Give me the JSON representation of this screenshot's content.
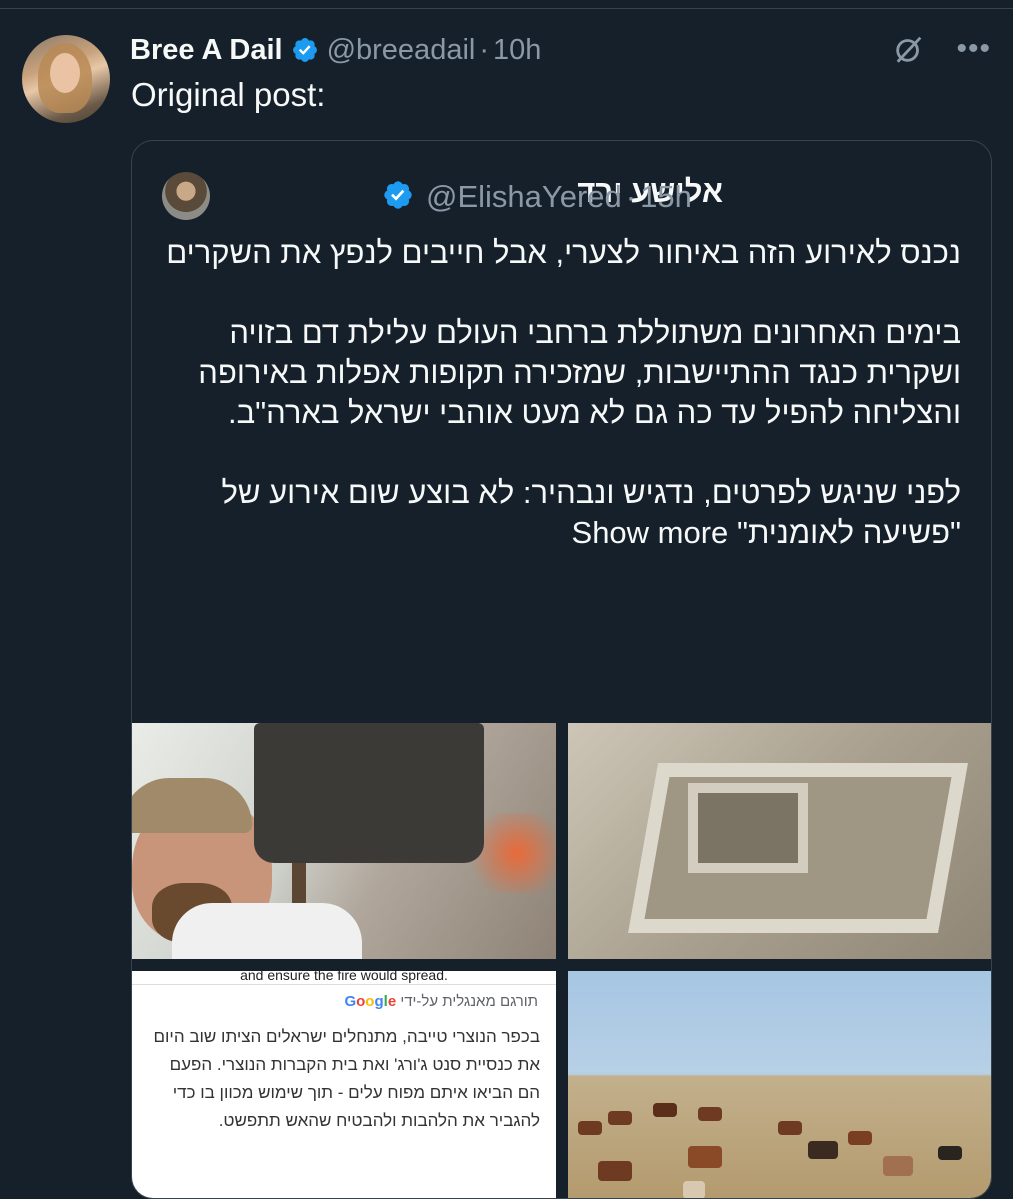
{
  "post": {
    "author_name": "Bree A Dail",
    "handle": "@breeadail",
    "time": "10h",
    "text": "Original post:"
  },
  "quoted": {
    "author_name": "אלישע ירד",
    "handle": "@ElishaYered",
    "time": "15h",
    "paragraphs": [
      "נכנס לאירוע הזה באיחור לצערי, אבל חייבים לנפץ את השקרים",
      "בימים האחרונים משתוללת ברחבי העולם עלילת דם בזויה ושקרית כנגד ההתיישבות, שמזכירה תקופות אפלות באירופה והצליחה להפיל עד כה גם לא מעט אוהבי ישראל בארה\"ב.",
      "לפני שניגש לפרטים, נדגיש ונבהיר: לא בוצע שום אירוע של \"פשיעה לאומנית\""
    ],
    "show_more": "Show more"
  },
  "translation_card": {
    "top_cut_text": "and ensure the fire would spread.",
    "translated_by": "תורגם מאנגלית על-ידי",
    "google": "Google",
    "body": "בכפר הנוצרי טייבה, מתנחלים ישראלים הציתו שוב היום את כנסיית סנט ג'ורג' ואת בית הקברות הנוצרי. הפעם הם הביאו איתם מפוח עלים - תוך שימוש מכוון בו כדי להגביר את הלהבות ולהבטיח שהאש תתפשט."
  },
  "icons": {
    "verified": "verified-badge-icon",
    "grok": "grok-icon",
    "more": "more-icon"
  },
  "colors": {
    "background": "#15202b",
    "border": "#38444d",
    "text": "#f7f9f9",
    "muted": "#8b98a5",
    "verified": "#1d9bf0"
  }
}
